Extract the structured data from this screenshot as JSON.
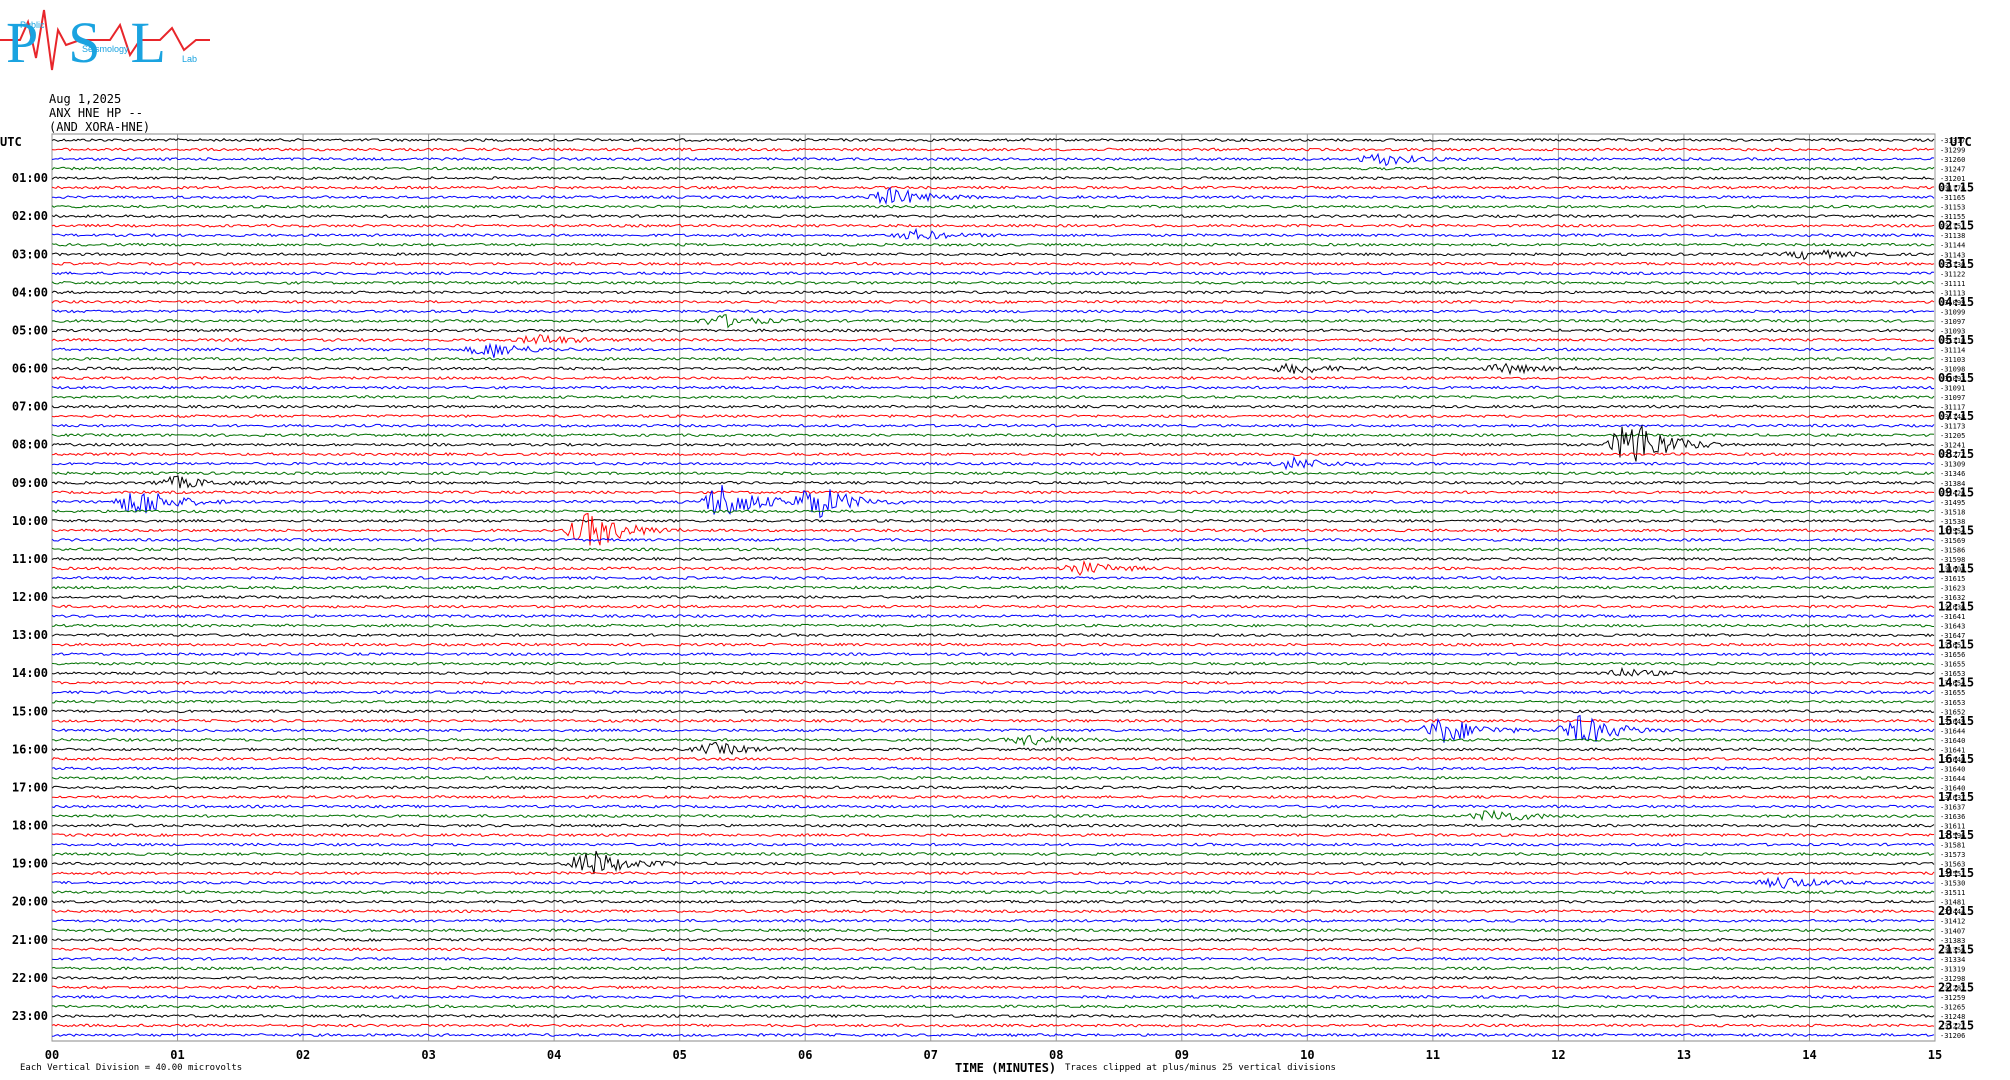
{
  "logo": {
    "letters": "PSL",
    "line1": "Public",
    "line2": "Seismology",
    "line3": "Lab",
    "colors": {
      "letters": "#1aa3e0",
      "wave": "#e8262b"
    }
  },
  "header": {
    "date": "Aug 1,2025",
    "station": "ANX HNE HP --",
    "source": "(AND XORA-HNE)",
    "left_utc": "UTC",
    "right_utc": "UTC"
  },
  "footer": {
    "scale": "Each Vertical Division =   40.00 microvolts",
    "xlabel": "TIME (MINUTES)",
    "clip_note": "Traces clipped at plus/minus 25 vertical divisions"
  },
  "chart_data": {
    "type": "line",
    "title": "",
    "xlabel": "TIME (MINUTES)",
    "ylabel": "UTC",
    "xlim": [
      0,
      15
    ],
    "x_ticks": [
      "00",
      "01",
      "02",
      "03",
      "04",
      "05",
      "06",
      "07",
      "08",
      "09",
      "10",
      "11",
      "12",
      "13",
      "14",
      "15"
    ],
    "grid": true,
    "trace_colors": [
      "#000000",
      "#ff0000",
      "#0000ff",
      "#007000"
    ],
    "traces_per_hour": 4,
    "left_hour_labels": [
      "01:00",
      "02:00",
      "03:00",
      "04:00",
      "05:00",
      "06:00",
      "07:00",
      "08:00",
      "09:00",
      "10:00",
      "11:00",
      "12:00",
      "13:00",
      "14:00",
      "15:00",
      "16:00",
      "17:00",
      "18:00",
      "19:00",
      "20:00",
      "21:00",
      "22:00",
      "23:00"
    ],
    "right_hour_labels": [
      "01:15",
      "02:15",
      "03:15",
      "04:15",
      "05:15",
      "06:15",
      "07:15",
      "08:15",
      "09:15",
      "10:15",
      "11:15",
      "12:15",
      "13:15",
      "14:15",
      "15:15",
      "16:15",
      "17:15",
      "18:15",
      "19:15",
      "20:15",
      "21:15",
      "22:15",
      "23:15"
    ],
    "trace_offsets": [
      "-31317",
      "-31299",
      "-31260",
      "-31247",
      "-31201",
      "-31176",
      "-31165",
      "-31153",
      "-31155",
      "-31151",
      "-31138",
      "-31144",
      "-31143",
      "-31130",
      "-31122",
      "-31111",
      "-31113",
      "-31099",
      "-31099",
      "-31097",
      "-31093",
      "-31110",
      "-31114",
      "-31103",
      "-31098",
      "-31093",
      "-31091",
      "-31097",
      "-31117",
      "-31148",
      "-31173",
      "-31205",
      "-31241",
      "-31272",
      "-31309",
      "-31346",
      "-31384",
      "-31426",
      "-31495",
      "-31518",
      "-31538",
      "-31554",
      "-31569",
      "-31586",
      "-31598",
      "-31608",
      "-31615",
      "-31623",
      "-31632",
      "-31636",
      "-31641",
      "-31643",
      "-31647",
      "-31651",
      "-31656",
      "-31655",
      "-31653",
      "-31654",
      "-31655",
      "-31653",
      "-31652",
      "-31649",
      "-31644",
      "-31640",
      "-31641",
      "-31640",
      "-31640",
      "-31644",
      "-31640",
      "-31637",
      "-31637",
      "-31636",
      "-31611",
      "-31596",
      "-31581",
      "-31573",
      "-31563",
      "-31551",
      "-31530",
      "-31511",
      "-31481",
      "-31444",
      "-31412",
      "-31407",
      "-31383",
      "-31356",
      "-31334",
      "-31319",
      "-31298",
      "-31282",
      "-31259",
      "-31265",
      "-31248",
      "-31227",
      "-31206"
    ],
    "events": [
      {
        "trace": 2,
        "x": 10.6,
        "amp": 6
      },
      {
        "trace": 6,
        "x": 6.7,
        "amp": 9
      },
      {
        "trace": 10,
        "x": 6.9,
        "amp": 5
      },
      {
        "trace": 12,
        "x": 14.0,
        "amp": 5
      },
      {
        "trace": 19,
        "x": 5.35,
        "amp": 6
      },
      {
        "trace": 21,
        "x": 3.9,
        "amp": 5
      },
      {
        "trace": 22,
        "x": 3.5,
        "amp": 8
      },
      {
        "trace": 24,
        "x": 9.9,
        "amp": 5
      },
      {
        "trace": 24,
        "x": 11.6,
        "amp": 5
      },
      {
        "trace": 32,
        "x": 12.6,
        "amp": 28
      },
      {
        "trace": 34,
        "x": 9.9,
        "amp": 6
      },
      {
        "trace": 36,
        "x": 1.0,
        "amp": 6
      },
      {
        "trace": 38,
        "x": 0.7,
        "amp": 16
      },
      {
        "trace": 38,
        "x": 5.35,
        "amp": 20
      },
      {
        "trace": 38,
        "x": 6.1,
        "amp": 18
      },
      {
        "trace": 41,
        "x": 4.3,
        "amp": 20
      },
      {
        "trace": 45,
        "x": 8.2,
        "amp": 7
      },
      {
        "trace": 56,
        "x": 12.5,
        "amp": 4
      },
      {
        "trace": 62,
        "x": 11.1,
        "amp": 14
      },
      {
        "trace": 62,
        "x": 12.2,
        "amp": 16
      },
      {
        "trace": 63,
        "x": 7.8,
        "amp": 5
      },
      {
        "trace": 64,
        "x": 5.3,
        "amp": 6
      },
      {
        "trace": 71,
        "x": 11.5,
        "amp": 7
      },
      {
        "trace": 76,
        "x": 4.3,
        "amp": 14
      },
      {
        "trace": 78,
        "x": 13.8,
        "amp": 6
      }
    ]
  }
}
